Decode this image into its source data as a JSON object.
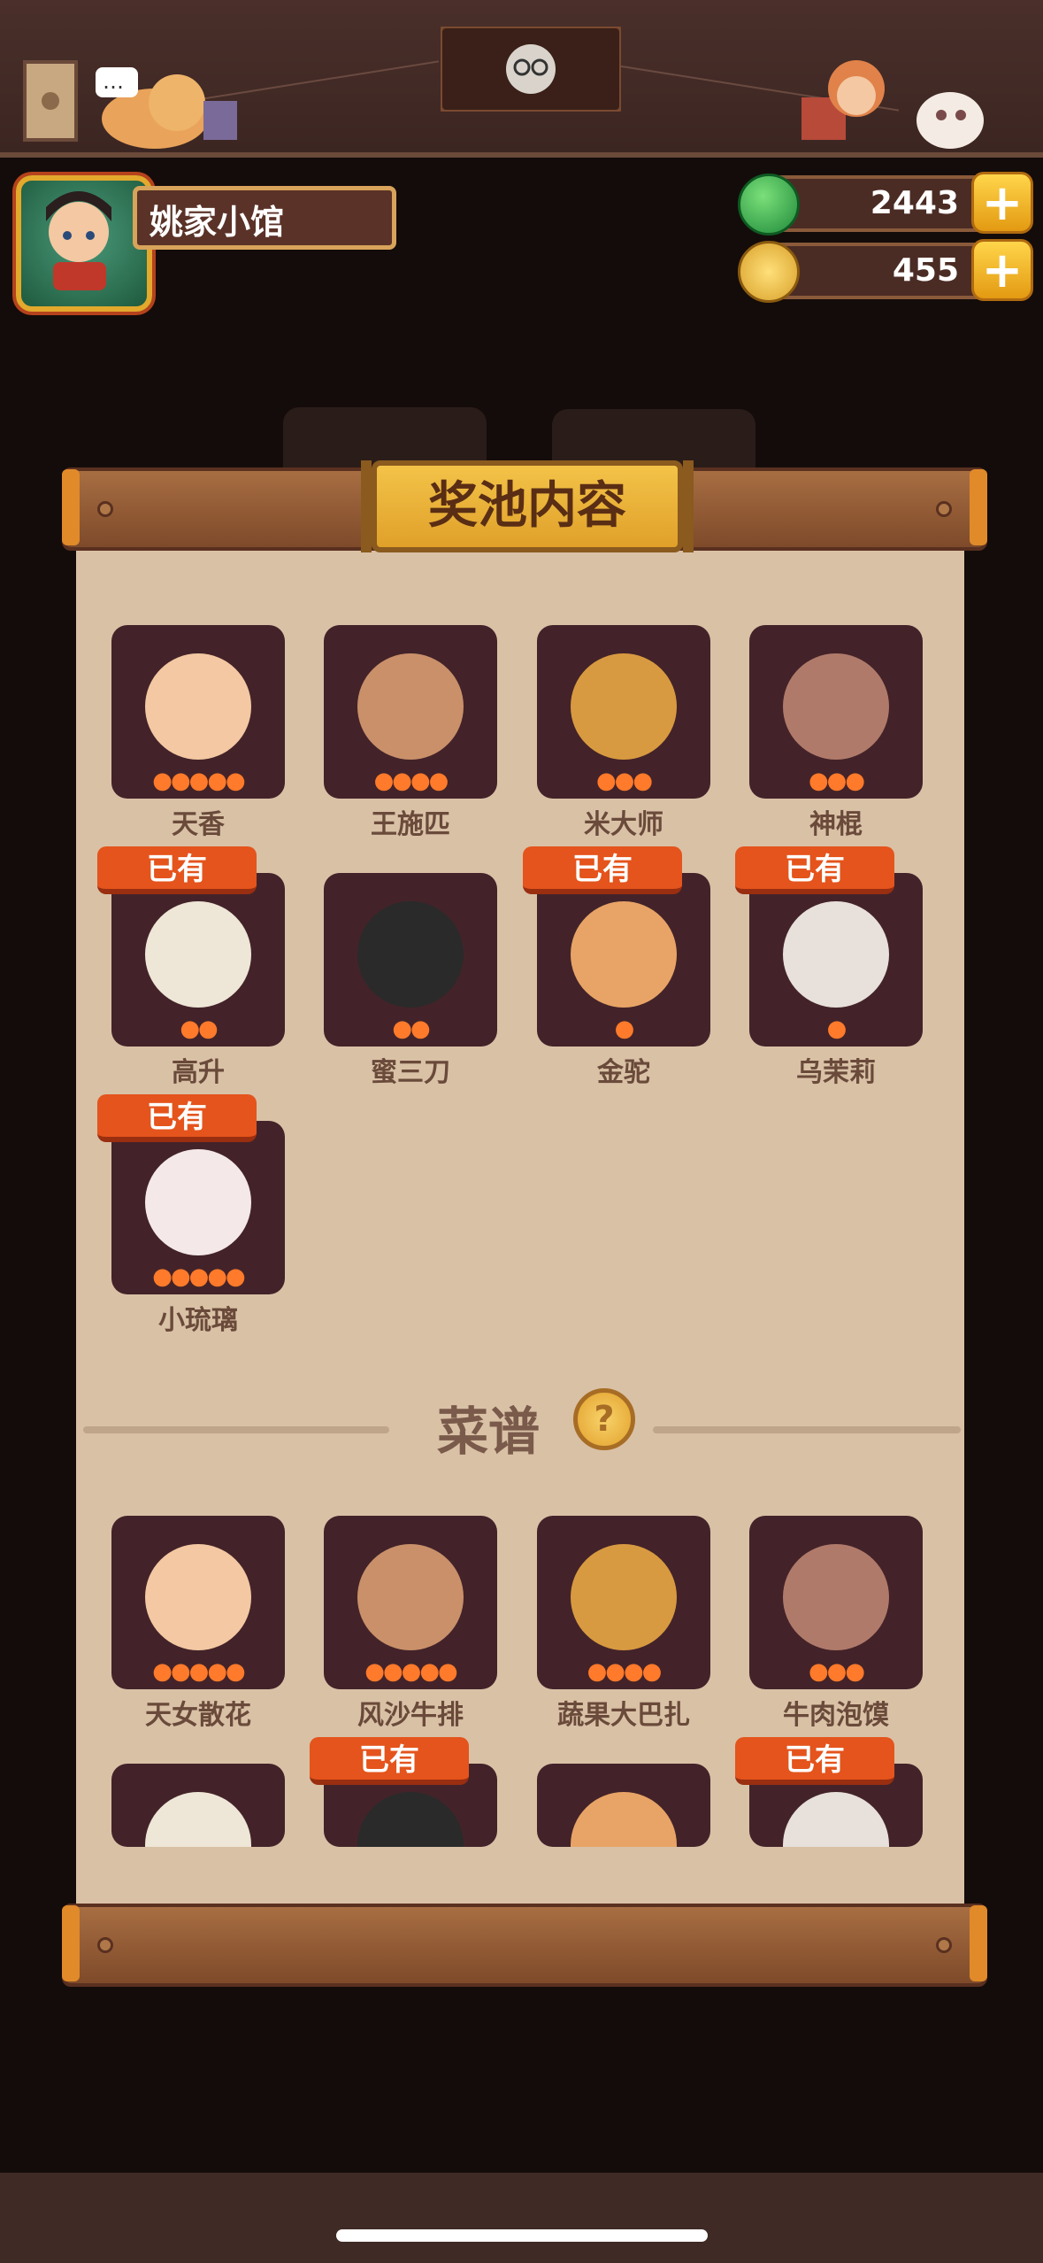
{
  "header": {
    "shop_name": "姚家小馆",
    "currency": [
      {
        "name": "jade",
        "value": "2443",
        "icon": "jade-coin-icon",
        "plus_label": "+"
      },
      {
        "name": "coin",
        "value": "455",
        "icon": "copper-coin-icon",
        "plus_label": "+"
      }
    ]
  },
  "panel": {
    "title": "奖池内容",
    "characters": [
      {
        "name": "天香",
        "stars": 5,
        "owned": false
      },
      {
        "name": "王施匹",
        "stars": 4,
        "owned": false
      },
      {
        "name": "米大师",
        "stars": 3,
        "owned": false
      },
      {
        "name": "神棍",
        "stars": 3,
        "owned": false
      },
      {
        "name": "高升",
        "stars": 2,
        "owned": true
      },
      {
        "name": "蜜三刀",
        "stars": 2,
        "owned": false
      },
      {
        "name": "金驼",
        "stars": 1,
        "owned": true
      },
      {
        "name": "乌茉莉",
        "stars": 1,
        "owned": true
      },
      {
        "name": "小琉璃",
        "stars": 5,
        "owned": true
      }
    ],
    "section_title": "菜谱",
    "help_label": "?",
    "recipes": [
      {
        "name": "天女散花",
        "stars": 5,
        "owned": false
      },
      {
        "name": "风沙牛排",
        "stars": 5,
        "owned": false
      },
      {
        "name": "蔬果大巴扎",
        "stars": 4,
        "owned": false
      },
      {
        "name": "牛肉泡馍",
        "stars": 3,
        "owned": false
      },
      {
        "name": "",
        "stars": 0,
        "owned": false
      },
      {
        "name": "",
        "stars": 0,
        "owned": true
      },
      {
        "name": "",
        "stars": 0,
        "owned": false
      },
      {
        "name": "",
        "stars": 0,
        "owned": true
      }
    ],
    "owned_label": "已有"
  },
  "colors": {
    "panel_bg": "#d9c1a6",
    "card_bg": "#432329",
    "owned_badge": "#e4541c",
    "title_gold": "#f3c348"
  }
}
